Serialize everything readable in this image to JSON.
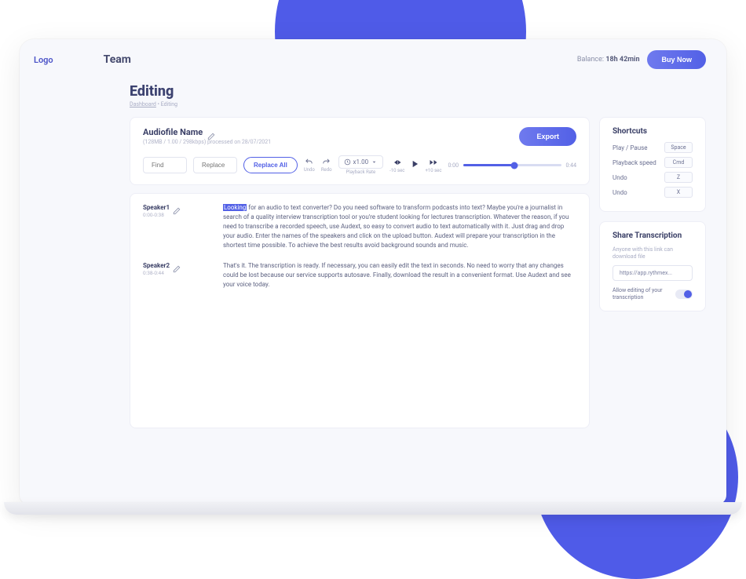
{
  "logo": "Logo",
  "team_title": "Team",
  "balance_label": "Balance:",
  "balance_value": "18h 42min",
  "buy_now": "Buy Now",
  "page_title": "Editing",
  "breadcrumb_dashboard": "Dashboard",
  "breadcrumb_sep": " • ",
  "breadcrumb_current": "Editing",
  "file": {
    "name": "Audiofile Name",
    "meta": "(128MB / 1.00 / 298kbps) processed on 28/07/2021"
  },
  "export_label": "Export",
  "find_placeholder": "Find",
  "replace_placeholder": "Replace",
  "replace_all": "Replace All",
  "undo_label": "Undo",
  "redo_label": "Redo",
  "rate_value": "x1.00",
  "rate_label": "Playback Rate",
  "skip_back": "-10 sec",
  "skip_fwd": "+10 sec",
  "time_start": "0:00",
  "time_end": "0:44",
  "progress_pct": 52,
  "segments": [
    {
      "speaker": "Speaker1",
      "time": "0:00-0:38",
      "text_highlight": "Looking",
      "text": " for an audio to text converter? Do you need software to transform podcasts into text? Maybe you're a journalist in search of a quality interview transcription tool or you're student looking for lectures transcription. Whatever the reason, if you need to transcribe a recorded speech, use Audext, so easy to convert audio to text automatically with it. Just drag and drop your audio. Enter the names of the speakers and click on the upload button. Audext will prepare your transcription in the shortest time possible. To achieve the best results avoid background sounds and music."
    },
    {
      "speaker": "Speaker2",
      "time": "0:38-0:44",
      "text": "That's it. The transcription is ready. If necessary, you can easily edit the text in seconds. No need to worry that any changes could be lost because our service supports autosave. Finally, download the result in a convenient format. Use Audext and see your voice today."
    }
  ],
  "shortcuts": {
    "title": "Shortcuts",
    "rows": [
      {
        "label": "Play / Pause",
        "key": "Space"
      },
      {
        "label": "Playback speed",
        "key": "Cmd"
      },
      {
        "label": "Undo",
        "key": "Z"
      },
      {
        "label": "Undo",
        "key": "X"
      }
    ]
  },
  "share": {
    "title": "Share Transcription",
    "subtitle": "Anyone with this link can download file",
    "link": "https://app.rythmex...",
    "toggle_label": "Allow editing of your transcription"
  }
}
